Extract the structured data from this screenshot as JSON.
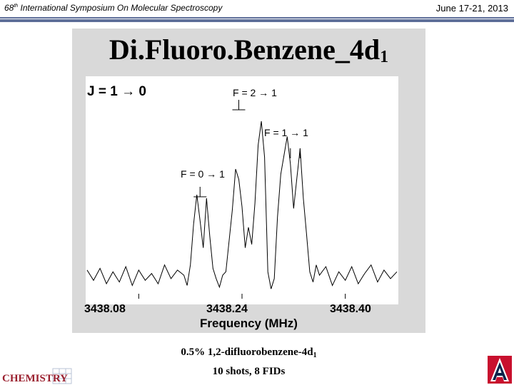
{
  "header": {
    "conference_prefix": "68",
    "conference_ordinal": "th",
    "conference_rest": " International Symposium On Molecular Spectroscopy",
    "date": "June 17-21, 2013",
    "rule_color": "#5e6f99"
  },
  "slide": {
    "title_main": "Di.Fluoro.Benzene_4d",
    "title_sub": "1",
    "panel_color": "#d9d9d9"
  },
  "annotations": {
    "j_transition": "J = 1 → 0",
    "f21": "F = 2 → 1",
    "f11": "F = 1 → 1",
    "f01": "F = 0 → 1"
  },
  "caption": {
    "line1_main": "0.5% 1,2-difluorobenzene-4d",
    "line1_sub": "1",
    "line2": "10 shots, 8 FIDs"
  },
  "logos": {
    "chemistry": "CHEMISTRY",
    "ua": "A",
    "ua_red": "#c8102e",
    "ua_blue": "#0c234b"
  },
  "chart_data": {
    "type": "line",
    "title": "",
    "xlabel": "Frequency (MHz)",
    "ylabel": "",
    "xlim": [
      3438.0,
      3438.48
    ],
    "ylim": [
      0,
      1
    ],
    "x_ticks": [
      3438.08,
      3438.24,
      3438.4
    ],
    "x_tick_labels": [
      "3438.08",
      "3438.24",
      "3438.40"
    ],
    "grid": false,
    "series": [
      {
        "values_x": [
          3438.0,
          3438.01,
          3438.02,
          3438.03,
          3438.04,
          3438.05,
          3438.06,
          3438.07,
          3438.08,
          3438.09,
          3438.1,
          3438.11,
          3438.12,
          3438.13,
          3438.14,
          3438.15,
          3438.155,
          3438.16,
          3438.165,
          3438.17,
          3438.175,
          3438.18,
          3438.185,
          3438.19,
          3438.195,
          3438.2,
          3438.205,
          3438.21,
          3438.215,
          3438.22,
          3438.225,
          3438.23,
          3438.235,
          3438.24,
          3438.245,
          3438.25,
          3438.255,
          3438.26,
          3438.265,
          3438.27,
          3438.275,
          3438.28,
          3438.285,
          3438.29,
          3438.295,
          3438.3,
          3438.305,
          3438.31,
          3438.315,
          3438.32,
          3438.325,
          3438.33,
          3438.335,
          3438.34,
          3438.345,
          3438.35,
          3438.355,
          3438.36,
          3438.37,
          3438.38,
          3438.39,
          3438.4,
          3438.41,
          3438.42,
          3438.43,
          3438.44,
          3438.45,
          3438.46,
          3438.47,
          3438.48
        ],
        "values_y": [
          0.13,
          0.07,
          0.14,
          0.05,
          0.12,
          0.06,
          0.15,
          0.04,
          0.13,
          0.07,
          0.11,
          0.05,
          0.16,
          0.08,
          0.13,
          0.1,
          0.04,
          0.16,
          0.4,
          0.57,
          0.42,
          0.26,
          0.55,
          0.33,
          0.14,
          0.08,
          0.03,
          0.1,
          0.12,
          0.3,
          0.48,
          0.72,
          0.66,
          0.5,
          0.26,
          0.38,
          0.28,
          0.52,
          0.86,
          1.0,
          0.79,
          0.12,
          0.02,
          0.08,
          0.44,
          0.69,
          0.8,
          0.91,
          0.75,
          0.49,
          0.67,
          0.84,
          0.55,
          0.34,
          0.12,
          0.06,
          0.16,
          0.1,
          0.15,
          0.04,
          0.12,
          0.07,
          0.15,
          0.05,
          0.11,
          0.16,
          0.06,
          0.13,
          0.08,
          0.12
        ]
      }
    ],
    "stick_markers": [
      3438.175,
      3438.235,
      3438.315,
      3438.33
    ]
  }
}
